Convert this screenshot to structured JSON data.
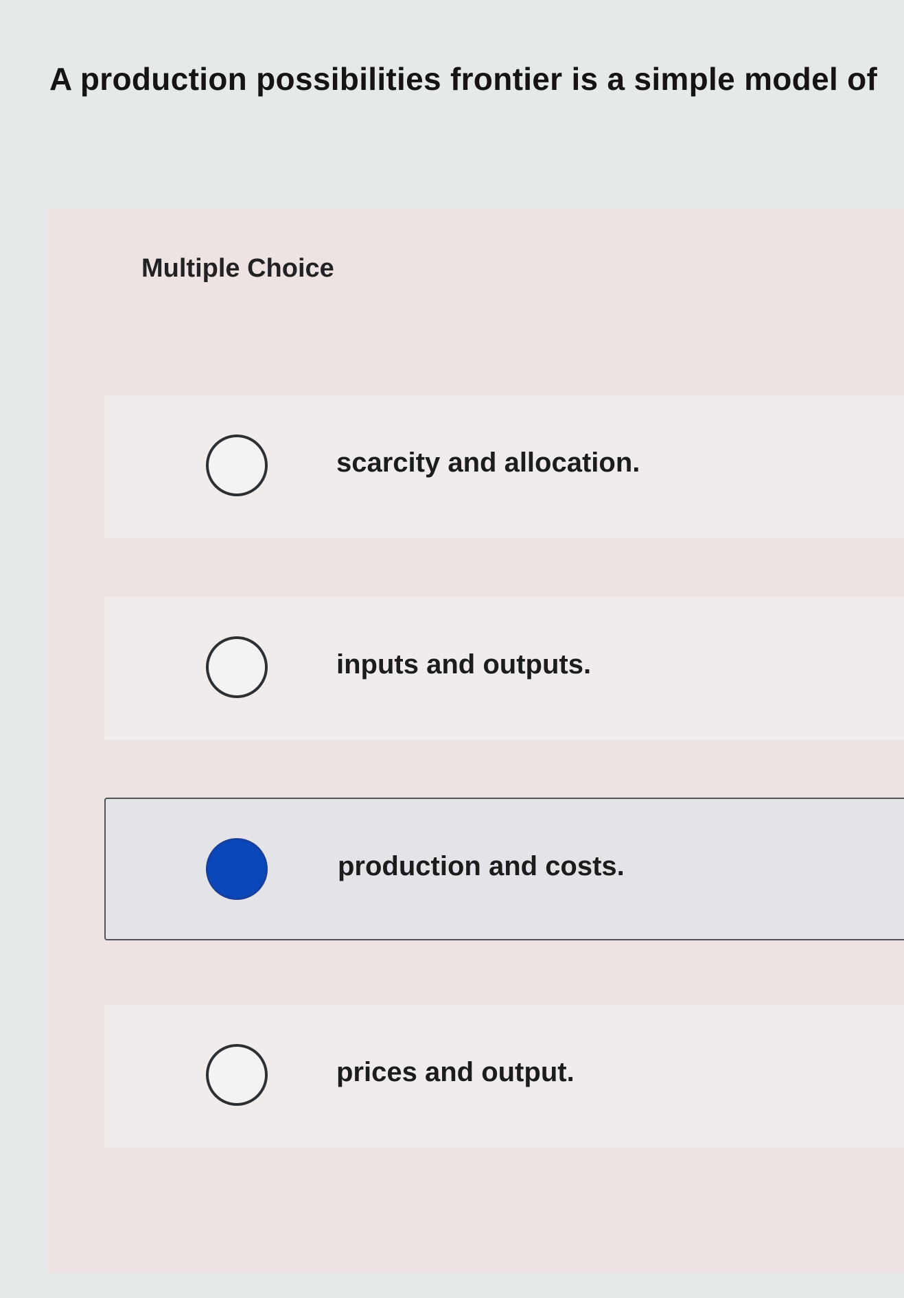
{
  "question": {
    "text": "A production possibilities frontier is a simple model of"
  },
  "panel": {
    "label": "Multiple Choice"
  },
  "options": [
    {
      "label": "scarcity and allocation.",
      "selected": false
    },
    {
      "label": "inputs and outputs.",
      "selected": false
    },
    {
      "label": "production and costs.",
      "selected": true
    },
    {
      "label": "prices and output.",
      "selected": false
    }
  ],
  "colors": {
    "selected_radio": "#0a47b8",
    "panel_background": "#ece3e2",
    "page_background": "#e6e9ea"
  }
}
